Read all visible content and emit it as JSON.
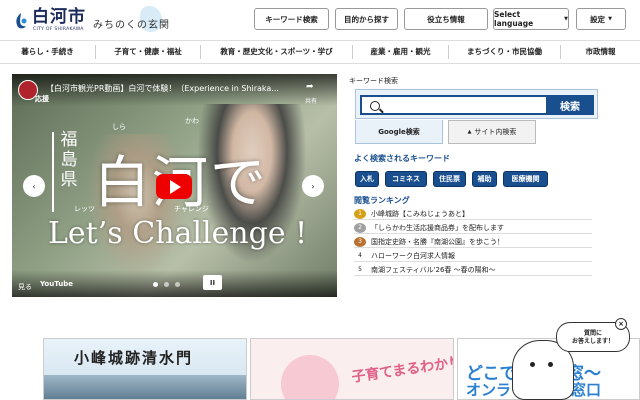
{
  "header": {
    "logo_title": "白河市",
    "logo_sub": "CITY OF SHIRAKAWA",
    "catchphrase": "みちのくの玄関",
    "buttons": [
      "キーワード検索",
      "目的から探す",
      "役立ち情報",
      "Select language",
      "設定"
    ]
  },
  "nav": {
    "items": [
      "暮らし・手続き",
      "子育て・健康・福祉",
      "教育・歴史文化・スポーツ・学び",
      "産業・雇用・観光",
      "まちづくり・市民協働",
      "市政情報"
    ]
  },
  "video": {
    "title": "【白河市観光PR動画】白河で体験！（Experience in Shiraka...",
    "channel_mark": "応援",
    "share_label": "共有",
    "vertical_text": "福島県",
    "big_text": "白河で",
    "ruby_shi": "しら",
    "ruby_kawa": "かわ",
    "lets_ruby": "レッツ",
    "challenge_ruby": "チャレンジ",
    "lets_text": "Let’s Challenge !",
    "watch_label": "見る",
    "youtube_label": "YouTube",
    "pause_label": "II",
    "prev_label": "‹",
    "next_label": "›"
  },
  "search": {
    "label": "キーワード検索",
    "placeholder": "",
    "button": "検索",
    "tab_google": "Google検索",
    "tab_site": "サイト内検索"
  },
  "frequent": {
    "title": "よく検索されるキーワード",
    "tags": [
      "入札",
      "コミネス",
      "住民票",
      "補助",
      "医療機関"
    ]
  },
  "ranking": {
    "title": "閲覧ランキング",
    "items": [
      {
        "num": "1",
        "text": "小峰城跡【こみねじょうあと】",
        "color": "#d4a017"
      },
      {
        "num": "2",
        "text": "「しらかわ生活応援商品券」を配布します",
        "color": "#a0a0a0"
      },
      {
        "num": "3",
        "text": "国指定史跡・名勝『南湖公園』を歩こう！",
        "color": "#b87333"
      },
      {
        "num": "4",
        "text": "ハローワーク白河求人情報",
        "color": "#ffffff"
      },
      {
        "num": "5",
        "text": "南湖フェスティバル'26春 ～春の陽和～",
        "color": "#ffffff"
      }
    ]
  },
  "banners": {
    "b1": "小峰城跡清水門",
    "b2": "子育てまるわかり",
    "b3_line1": "どこで～どこ窓～",
    "b3_line2": "オンライン相談窓口"
  },
  "chat": {
    "text_line1": "質問に",
    "text_line2": "お答えします！",
    "close": "×"
  }
}
